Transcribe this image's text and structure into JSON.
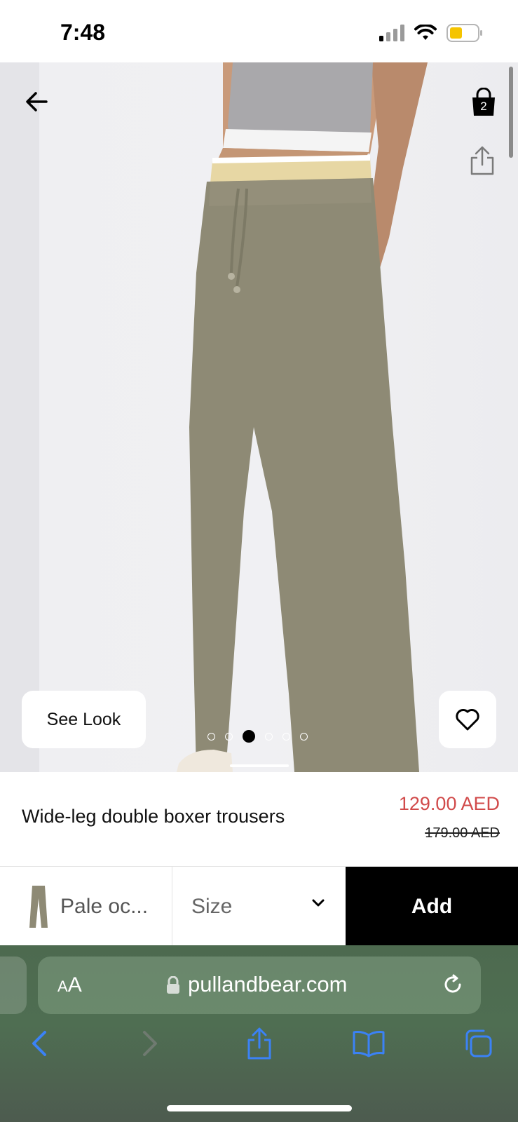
{
  "status_bar": {
    "time": "7:48",
    "icons": [
      "cellular-signal-icon",
      "wifi-icon",
      "battery-icon"
    ],
    "battery_color": "#f5c400"
  },
  "product_gallery": {
    "see_look_label": "See Look",
    "dots_count": 6,
    "active_dot": 3,
    "bag_count": "2"
  },
  "product": {
    "name": "Wide-leg double boxer trousers",
    "price": "129.00 AED",
    "old_price": "179.00 AED",
    "price_color": "#d14a4a"
  },
  "buy_bar": {
    "color_label": "Pale oc...",
    "size_label": "Size",
    "add_label": "Add"
  },
  "browser": {
    "text_size_label_small": "A",
    "text_size_label_large": "A",
    "url": "pullandbear.com",
    "icons": [
      "back-icon",
      "forward-icon",
      "share-icon",
      "bookmarks-icon",
      "tabs-icon"
    ],
    "accent": "#3b82f6"
  }
}
